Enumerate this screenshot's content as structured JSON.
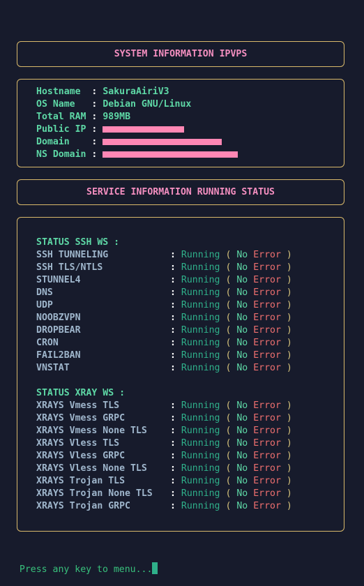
{
  "sections": {
    "system_title": "SYSTEM INFORMATION IPVPS",
    "service_title": "SERVICE INFORMATION RUNNING STATUS"
  },
  "sysinfo": [
    {
      "label": "Hostname  ",
      "value": "SakuraAiriV3"
    },
    {
      "label": "OS Name   ",
      "value": "Debian GNU/Linux"
    },
    {
      "label": "Total RAM ",
      "value": "989MB"
    },
    {
      "label": "Public IP ",
      "value": ""
    },
    {
      "label": "Domain    ",
      "value": ""
    },
    {
      "label": "NS Domain ",
      "value": ""
    }
  ],
  "separator": ":",
  "ssh_heading": "STATUS SSH WS :",
  "xray_heading": "STATUS XRAY WS :",
  "status": {
    "running": "Running",
    "open": "(",
    "no": "No",
    "error": "Error",
    "close": ")"
  },
  "ssh_services": [
    "SSH TUNNELING",
    "SSH TLS/NTLS",
    "STUNNEL4",
    "DNS",
    "UDP",
    "NOOBZVPN",
    "DROPBEAR",
    "CRON",
    "FAIL2BAN",
    "VNSTAT"
  ],
  "xray_services": [
    "XRAYS Vmess TLS",
    "XRAYS Vmess GRPC",
    "XRAYS Vmess None TLS",
    "XRAYS Vless TLS",
    "XRAYS Vless GRPC",
    "XRAYS Vless None TLS",
    "XRAYS Trojan TLS",
    "XRAYS Trojan None TLS",
    "XRAYS Trojan GRPC"
  ],
  "prompt": "Press any key to menu...",
  "colors": {
    "border": "#d9b96b",
    "title": "#f48fc0",
    "label": "#5ed8a6",
    "running": "#2fb08a",
    "error": "#ee6f6f",
    "background": "#171b2c"
  }
}
